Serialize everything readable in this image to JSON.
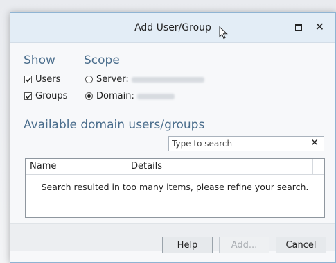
{
  "dialog": {
    "title": "Add User/Group"
  },
  "show": {
    "heading": "Show",
    "users_label": "Users",
    "users_checked": true,
    "groups_label": "Groups",
    "groups_checked": true
  },
  "scope": {
    "heading": "Scope",
    "server_label": "Server:",
    "server_selected": false,
    "domain_label": "Domain:",
    "domain_selected": true
  },
  "available": {
    "heading": "Available domain users/groups"
  },
  "search": {
    "placeholder": "Type to search",
    "value": ""
  },
  "list": {
    "columns": [
      "Name",
      "Details"
    ],
    "message": "Search resulted in too many items, please refine your search."
  },
  "buttons": {
    "help": "Help",
    "add": "Add...",
    "cancel": "Cancel"
  },
  "icons": {
    "maximize": "maximize-icon",
    "close": "close-icon",
    "clear": "clear-icon",
    "cursor": "mouse-pointer-icon"
  }
}
